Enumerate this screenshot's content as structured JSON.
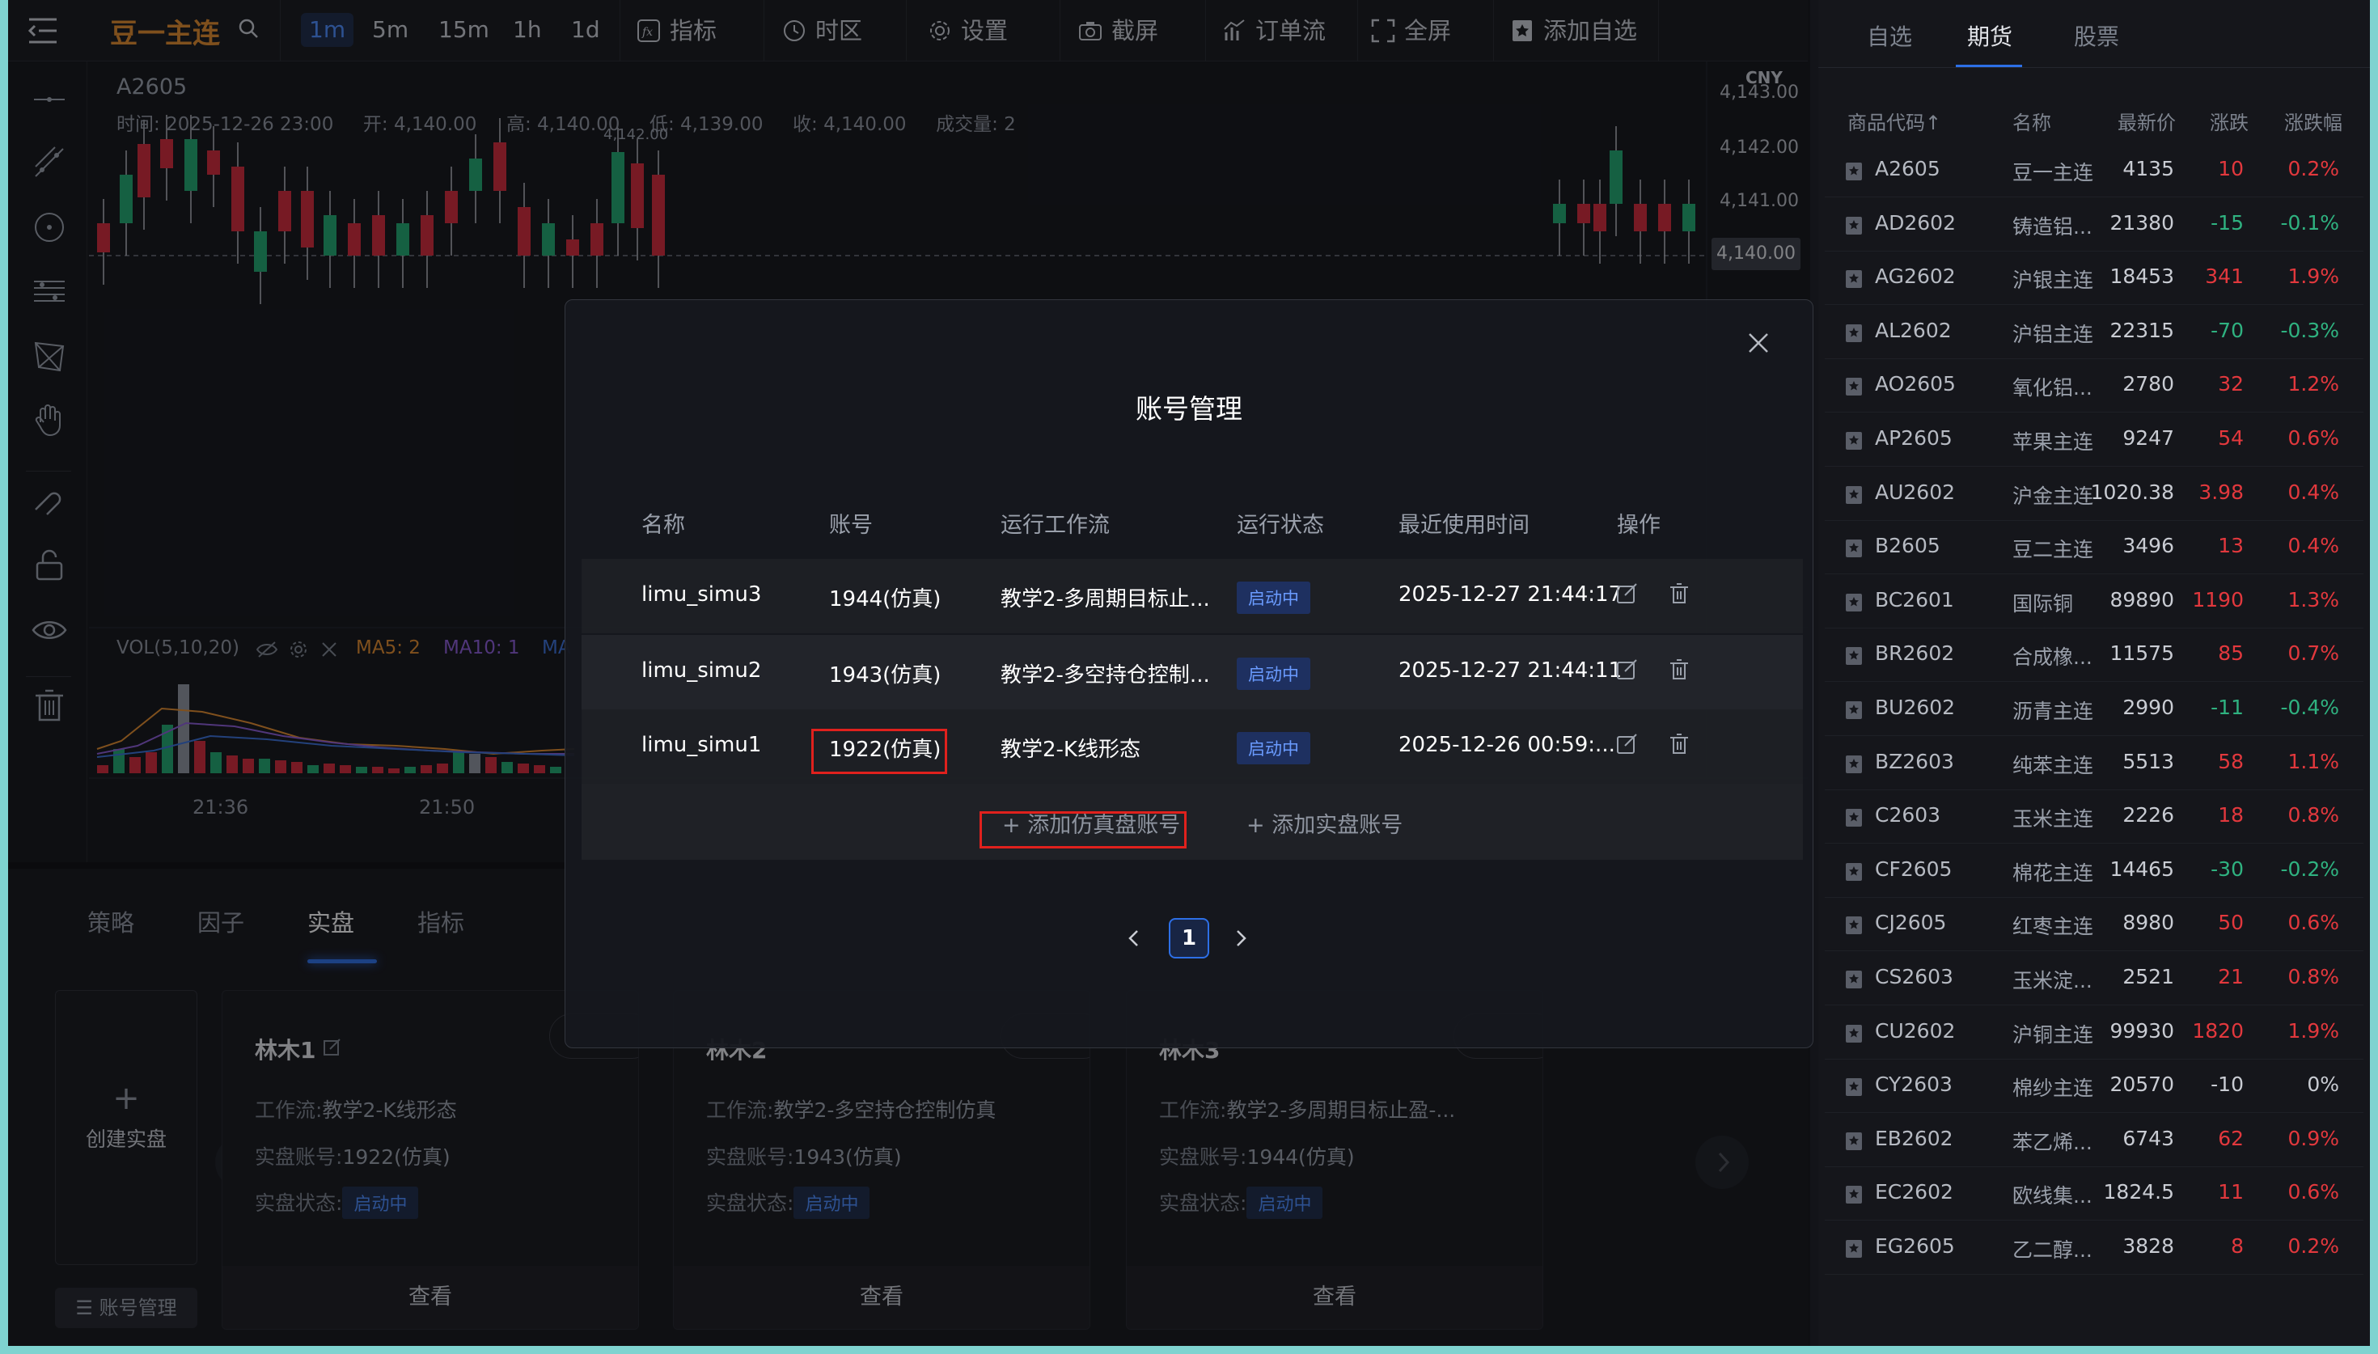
{
  "toolbar": {
    "symbol": "豆一主连",
    "timeframes": [
      "1m",
      "5m",
      "15m",
      "1h",
      "1d"
    ],
    "active_timeframe": "1m",
    "indicators_label": "指标",
    "timezone_label": "时区",
    "settings_label": "设置",
    "screenshot_label": "截屏",
    "orderflow_label": "订单流",
    "fullscreen_label": "全屏",
    "add_watch_label": "添加自选"
  },
  "chart": {
    "symbol_code": "A2605",
    "info_time_label": "时间:",
    "info_time": "2025-12-26 23:00",
    "info_open_label": "开:",
    "info_open": "4,140.00",
    "info_high_label": "高:",
    "info_high": "4,140.00",
    "info_low_label": "低:",
    "info_low": "4,139.00",
    "info_close_label": "收:",
    "info_close": "4,140.00",
    "info_volume_label": "成交量:",
    "info_volume": "2",
    "currency": "CNY",
    "price_ticks": [
      "4,143.00",
      "4,142.00",
      "4,141.00"
    ],
    "current_price": "4,140.00",
    "peak_label": "4,142.00",
    "vol_label": "VOL(5,10,20)",
    "ma5": "MA5: 2",
    "ma10": "MA10: 1",
    "ma20": "MA",
    "time_ticks": [
      "21:36",
      "21:50"
    ],
    "colors": {
      "up": "#d2293a",
      "down": "#20a86f",
      "ma5": "#e08a2c",
      "ma10": "#8a5cd6",
      "ma20": "#3a6fd8"
    }
  },
  "bottom": {
    "tabs": [
      "策略",
      "因子",
      "实盘",
      "指标"
    ],
    "active_tab": "实盘",
    "create_label": "创建实盘",
    "account_mgr_label": "账号管理",
    "cards": [
      {
        "name": "林木1",
        "workflow_label": "工作流:",
        "workflow": "教学2-K线形态",
        "account_label": "实盘账号:",
        "account": "1922(仿真)",
        "status_label": "实盘状态:",
        "status": "启动中",
        "view": "查看"
      },
      {
        "name": "林木2",
        "workflow_label": "工作流:",
        "workflow": "教学2-多空持仓控制仿真",
        "account_label": "实盘账号:",
        "account": "1943(仿真)",
        "status_label": "实盘状态:",
        "status": "启动中",
        "view": "查看"
      },
      {
        "name": "林木3",
        "workflow_label": "工作流:",
        "workflow": "教学2-多周期目标止盈-...",
        "account_label": "实盘账号:",
        "account": "1944(仿真)",
        "status_label": "实盘状态:",
        "status": "启动中",
        "view": "查看"
      }
    ]
  },
  "modal": {
    "title": "账号管理",
    "headers": [
      "名称",
      "账号",
      "运行工作流",
      "运行状态",
      "最近使用时间",
      "操作"
    ],
    "rows": [
      {
        "name": "limu_simu3",
        "account": "1944(仿真)",
        "workflow": "教学2-多周期目标止...",
        "status": "启动中",
        "last_used": "2025-12-27 21:44:17"
      },
      {
        "name": "limu_simu2",
        "account": "1943(仿真)",
        "workflow": "教学2-多空持仓控制...",
        "status": "启动中",
        "last_used": "2025-12-27 21:44:11"
      },
      {
        "name": "limu_simu1",
        "account": "1922(仿真)",
        "workflow": "教学2-K线形态",
        "status": "启动中",
        "last_used": "2025-12-26 00:59:..."
      }
    ],
    "add_sim_label": "添加仿真盘账号",
    "add_real_label": "添加实盘账号",
    "page": "1",
    "highlight_color": "#e0211d"
  },
  "watchlist": {
    "tabs": [
      "自选",
      "期货",
      "股票"
    ],
    "active_tab": "期货",
    "headers": [
      "商品代码↑",
      "名称",
      "最新价",
      "涨跌",
      "涨跌幅"
    ],
    "rows": [
      {
        "code": "A2605",
        "name": "豆一主连",
        "price": "4135",
        "chg": "10",
        "pct": "0.2%",
        "dir": "up"
      },
      {
        "code": "AD2602",
        "name": "铸造铝...",
        "price": "21380",
        "chg": "-15",
        "pct": "-0.1%",
        "dir": "down"
      },
      {
        "code": "AG2602",
        "name": "沪银主连",
        "price": "18453",
        "chg": "341",
        "pct": "1.9%",
        "dir": "up"
      },
      {
        "code": "AL2602",
        "name": "沪铝主连",
        "price": "22315",
        "chg": "-70",
        "pct": "-0.3%",
        "dir": "down"
      },
      {
        "code": "AO2605",
        "name": "氧化铝...",
        "price": "2780",
        "chg": "32",
        "pct": "1.2%",
        "dir": "up"
      },
      {
        "code": "AP2605",
        "name": "苹果主连",
        "price": "9247",
        "chg": "54",
        "pct": "0.6%",
        "dir": "up"
      },
      {
        "code": "AU2602",
        "name": "沪金主连",
        "price": "1020.38",
        "chg": "3.98",
        "pct": "0.4%",
        "dir": "up"
      },
      {
        "code": "B2605",
        "name": "豆二主连",
        "price": "3496",
        "chg": "13",
        "pct": "0.4%",
        "dir": "up"
      },
      {
        "code": "BC2601",
        "name": "国际铜",
        "price": "89890",
        "chg": "1190",
        "pct": "1.3%",
        "dir": "up"
      },
      {
        "code": "BR2602",
        "name": "合成橡...",
        "price": "11575",
        "chg": "85",
        "pct": "0.7%",
        "dir": "up"
      },
      {
        "code": "BU2602",
        "name": "沥青主连",
        "price": "2990",
        "chg": "-11",
        "pct": "-0.4%",
        "dir": "down"
      },
      {
        "code": "BZ2603",
        "name": "纯苯主连",
        "price": "5513",
        "chg": "58",
        "pct": "1.1%",
        "dir": "up"
      },
      {
        "code": "C2603",
        "name": "玉米主连",
        "price": "2226",
        "chg": "18",
        "pct": "0.8%",
        "dir": "up"
      },
      {
        "code": "CF2605",
        "name": "棉花主连",
        "price": "14465",
        "chg": "-30",
        "pct": "-0.2%",
        "dir": "down"
      },
      {
        "code": "CJ2605",
        "name": "红枣主连",
        "price": "8980",
        "chg": "50",
        "pct": "0.6%",
        "dir": "up"
      },
      {
        "code": "CS2603",
        "name": "玉米淀...",
        "price": "2521",
        "chg": "21",
        "pct": "0.8%",
        "dir": "up"
      },
      {
        "code": "CU2602",
        "name": "沪铜主连",
        "price": "99930",
        "chg": "1820",
        "pct": "1.9%",
        "dir": "up"
      },
      {
        "code": "CY2603",
        "name": "棉纱主连",
        "price": "20570",
        "chg": "-10",
        "pct": "0%",
        "dir": "flat"
      },
      {
        "code": "EB2602",
        "name": "苯乙烯...",
        "price": "6743",
        "chg": "62",
        "pct": "0.9%",
        "dir": "up"
      },
      {
        "code": "EC2602",
        "name": "欧线集...",
        "price": "1824.5",
        "chg": "11",
        "pct": "0.6%",
        "dir": "up"
      },
      {
        "code": "EG2605",
        "name": "乙二醇...",
        "price": "3828",
        "chg": "8",
        "pct": "0.2%",
        "dir": "up"
      }
    ]
  }
}
